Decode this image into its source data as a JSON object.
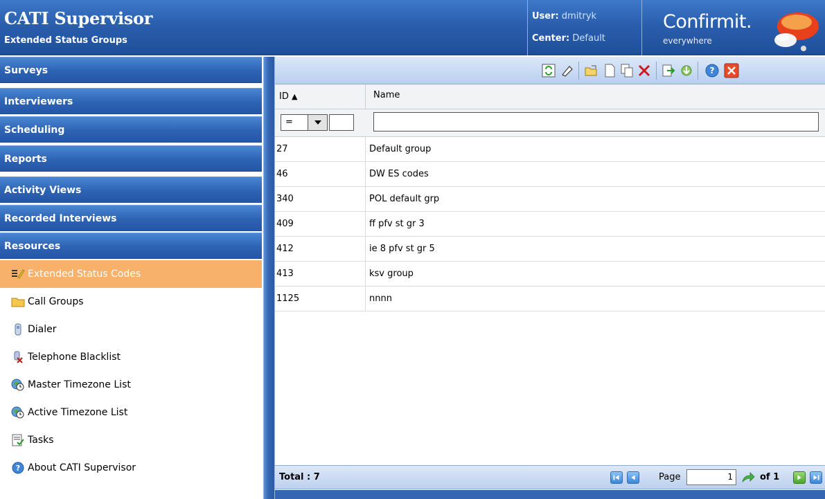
{
  "header": {
    "title": "CATI Supervisor",
    "subtitle": "Extended Status Groups",
    "user_label": "User:",
    "user_value": "dmitryk",
    "center_label": "Center:",
    "center_value": "Default",
    "brand": "Confirmit.",
    "brand_tagline": "everywhere"
  },
  "sidebar": {
    "groups": [
      {
        "label": "Surveys"
      },
      {
        "label": "Interviewers"
      },
      {
        "label": "Scheduling"
      },
      {
        "label": "Reports"
      },
      {
        "label": "Activity Views"
      },
      {
        "label": "Recorded Interviews"
      },
      {
        "label": "Resources"
      }
    ],
    "resources_items": [
      {
        "label": "Extended Status Codes",
        "icon": "edit-codes-icon",
        "active": true
      },
      {
        "label": "Call Groups",
        "icon": "folder-icon"
      },
      {
        "label": "Dialer",
        "icon": "phone-icon"
      },
      {
        "label": "Telephone Blacklist",
        "icon": "blacklist-icon"
      },
      {
        "label": "Master Timezone List",
        "icon": "globe-clock-icon"
      },
      {
        "label": "Active Timezone List",
        "icon": "globe-clock-icon"
      },
      {
        "label": "Tasks",
        "icon": "tasks-icon"
      },
      {
        "label": "About CATI Supervisor",
        "icon": "help-icon"
      }
    ]
  },
  "toolbar": {
    "buttons": [
      "refresh-icon",
      "eraser-icon",
      "open-folder-icon",
      "new-document-icon",
      "copy-icon",
      "delete-icon",
      "export-icon",
      "import-icon",
      "help-icon",
      "close-icon"
    ]
  },
  "grid": {
    "columns": {
      "id": "ID",
      "name": "Name"
    },
    "sort_indicator": "▲",
    "filter_operator": "=",
    "rows": [
      {
        "id": "27",
        "name": "Default group"
      },
      {
        "id": "46",
        "name": "DW ES codes"
      },
      {
        "id": "340",
        "name": "POL default grp"
      },
      {
        "id": "409",
        "name": "ff pfv st gr 3"
      },
      {
        "id": "412",
        "name": "ie 8 pfv st gr 5"
      },
      {
        "id": "413",
        "name": "ksv group"
      },
      {
        "id": "1125",
        "name": "nnnn"
      }
    ]
  },
  "footer": {
    "total": "Total : 7",
    "page_label": "Page",
    "page_value": "1",
    "page_of": "of 1"
  },
  "colors": {
    "header_blue": "#2a5fae",
    "active_item": "#f7b16b",
    "toolbar": "#c9daf3"
  }
}
